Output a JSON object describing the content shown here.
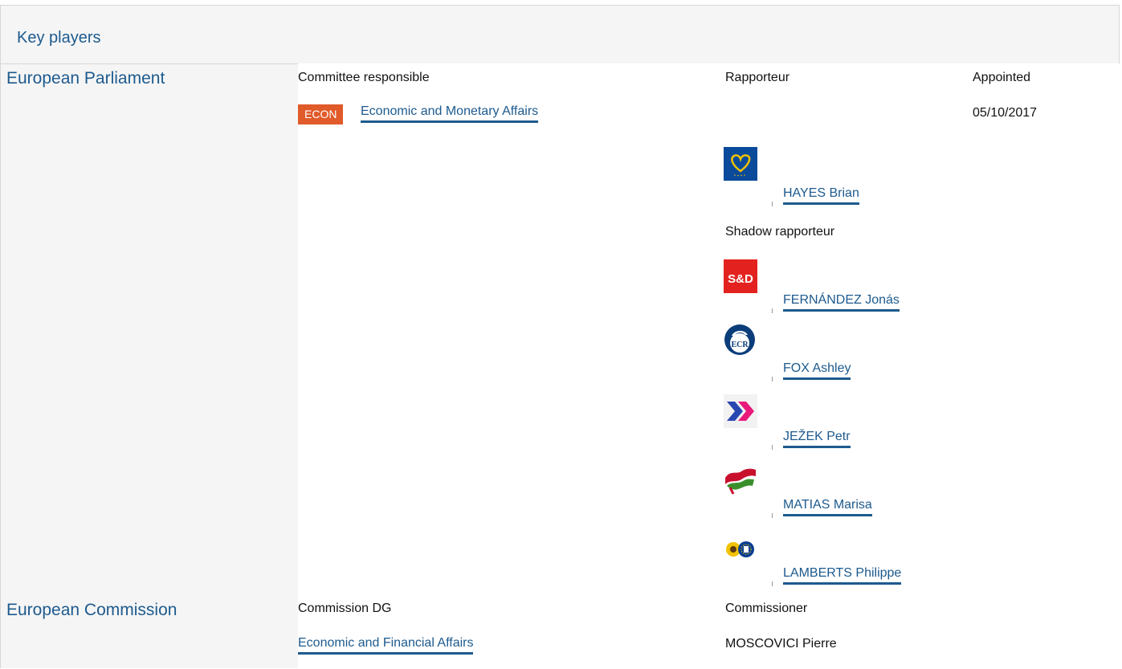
{
  "header": {
    "title": "Key players"
  },
  "parliament": {
    "label": "European Parliament",
    "committee_heading": "Committee responsible",
    "rapporteur_heading": "Rapporteur",
    "appointed_heading": "Appointed",
    "committee_badge": "ECON",
    "committee_name": "Economic and Monetary Affairs",
    "appointed_date": "05/10/2017",
    "rapporteur": {
      "name": "HAYES Brian",
      "group_icon": "epp-heart-logo"
    },
    "shadow_heading": "Shadow rapporteur",
    "shadows": [
      {
        "name": "FERNÁNDEZ Jonás",
        "group_icon": "s-and-d-logo",
        "logo_text": "S&D"
      },
      {
        "name": "FOX Ashley",
        "group_icon": "ecr-logo",
        "logo_text": "ECR"
      },
      {
        "name": "JEŽEK Petr",
        "group_icon": "alde-chevrons-logo"
      },
      {
        "name": "MATIAS Marisa",
        "group_icon": "gue-ngl-flag-logo"
      },
      {
        "name": "LAMBERTS Philippe",
        "group_icon": "greens-efa-sunflower-logo"
      }
    ]
  },
  "commission": {
    "label": "European Commission",
    "dg_heading": "Commission DG",
    "commissioner_heading": "Commissioner",
    "dg_name": "Economic and Financial Affairs",
    "commissioner_name": "MOSCOVICI Pierre"
  },
  "colors": {
    "link": "#1d5a8e",
    "badge": "#e05a2a",
    "panel_bg": "#f5f5f5",
    "epp_blue": "#0a4a9a",
    "sd_red": "#e3221f",
    "ecr_blue": "#0b3d7a",
    "alde_blue": "#2a47b0",
    "alde_pink": "#e8197a",
    "gue_red": "#c8102e",
    "gue_green": "#3a8f2d",
    "greens_yellow": "#f2c200"
  }
}
